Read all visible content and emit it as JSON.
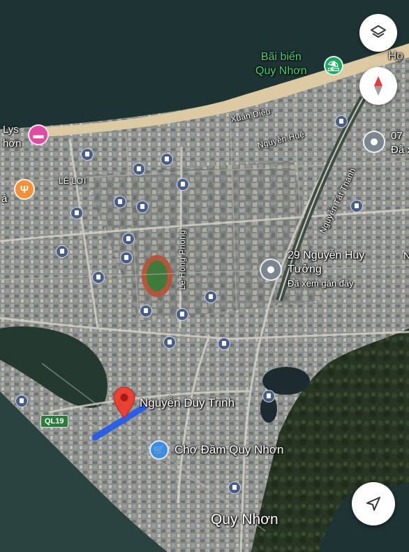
{
  "map": {
    "city_label": "Quy Nhơn",
    "beach": {
      "line1": "Bãi biển",
      "line2": "Quy Nhơn"
    },
    "partial_top_right": "Họ",
    "streets": {
      "xuan_dieu": "Xuân Diệu",
      "nguyen_hue": "Nguyễn Huệ",
      "le_loi": "LÊ LỢI",
      "le_hong_phong": "Lê Hồng Phong",
      "nguyen_tat_thanh": "Nguyễn Tất Thành",
      "nguyen_duy_trinh": "Nguyễn Duy Trinh"
    },
    "route_shield": "QL19",
    "left_edge": {
      "hotel_line1": "Lys",
      "hotel_line2": "hơn",
      "restaurant_partial": "ả"
    },
    "places": {
      "saved": {
        "line1": "29 Nguyễn Huy",
        "line2": "Tưởng",
        "note": "Đã xem gần đây"
      },
      "right_edge": {
        "line1": "07",
        "line2": "Đã x"
      },
      "market": "Chợ Đầm Quy Nhơn",
      "right_partial": "N"
    },
    "icons": {
      "layers": "layers-icon",
      "compass": "compass-icon",
      "navigate": "navigation-arrow-icon",
      "bus_stop": "bus-stop-icon",
      "beach": "beach-umbrella-icon",
      "hotel": "bed-icon",
      "restaurant": "fork-knife-icon",
      "shopping": "shopping-cart-icon",
      "pin": "location-pin-icon"
    },
    "colors": {
      "sea": "#1f3536",
      "beach_sand": "#d9c9a4",
      "route_blue": "#2b5fe6",
      "pin_red": "#e94235",
      "hotel_pink": "#e04ba6",
      "food_orange": "#f29137",
      "shop_blue": "#3b8ee8",
      "beach_green": "#1fa763",
      "saved_gray": "#7c8690"
    }
  }
}
